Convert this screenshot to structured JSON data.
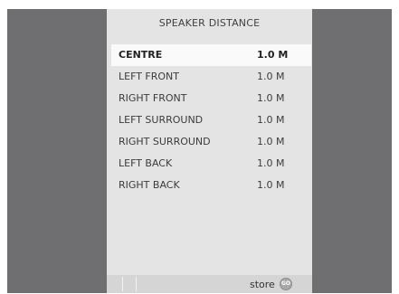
{
  "menu": {
    "title": "SPEAKER  DISTANCE",
    "items": [
      {
        "label": "CENTRE",
        "value": "1.0 M",
        "selected": true
      },
      {
        "label": "LEFT  FRONT",
        "value": "1.0 M",
        "selected": false
      },
      {
        "label": "RIGHT  FRONT",
        "value": "1.0 M",
        "selected": false
      },
      {
        "label": "LEFT  SURROUND",
        "value": "1.0 M",
        "selected": false
      },
      {
        "label": "RIGHT  SURROUND",
        "value": "1.0 M",
        "selected": false
      },
      {
        "label": "LEFT  BACK",
        "value": "1.0 M",
        "selected": false
      },
      {
        "label": "RIGHT  BACK",
        "value": "1.0 M",
        "selected": false
      }
    ]
  },
  "footer": {
    "action_label": "store",
    "go_icon": {
      "name": "go-icon",
      "text": "GO"
    }
  },
  "colors": {
    "background": "#6f6f71",
    "panel": "#e4e4e4",
    "highlight": "#fafafa"
  }
}
